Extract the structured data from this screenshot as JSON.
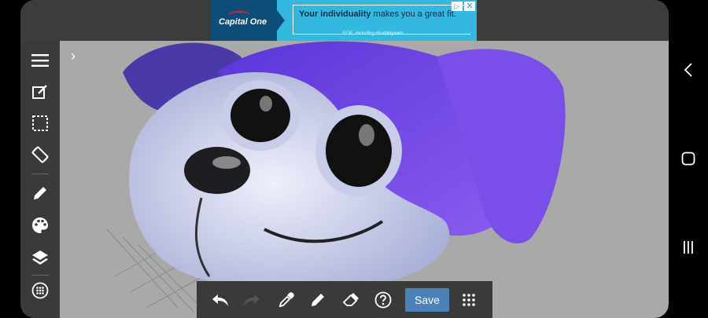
{
  "ad": {
    "brand": "Capital One",
    "headline_bold": "Your individuality",
    "headline_rest": " makes you a great fit.",
    "fine_print": "EOE, including disability/vets",
    "adchoices_icon": "▷",
    "close_icon": "✕",
    "colors": {
      "background": "#35b8e0",
      "brand": "#0d4d78",
      "accent": "#d8232a"
    }
  },
  "canvas": {
    "background": "#a9a9a9",
    "expand_icon": "›"
  },
  "left_toolbar": {
    "items": [
      {
        "name": "menu",
        "icon": "menu-icon"
      },
      {
        "name": "edit",
        "icon": "edit-note-icon"
      },
      {
        "name": "select",
        "icon": "selection-icon"
      },
      {
        "name": "rotate",
        "icon": "screen-rotation-icon"
      },
      {
        "name": "brush",
        "icon": "pencil-icon"
      },
      {
        "name": "colors",
        "icon": "palette-icon"
      },
      {
        "name": "layers",
        "icon": "layers-icon"
      },
      {
        "name": "more",
        "icon": "dots-circle-icon"
      }
    ]
  },
  "bottom_toolbar": {
    "save_label": "Save",
    "items": [
      "undo-icon",
      "redo-icon",
      "eyedropper-icon",
      "pencil-icon",
      "eraser-icon",
      "help-icon",
      "grid-menu-icon"
    ],
    "save_color": "#4a82b8"
  },
  "system_nav": {
    "items": [
      "back-icon",
      "home-icon",
      "recents-icon"
    ]
  }
}
